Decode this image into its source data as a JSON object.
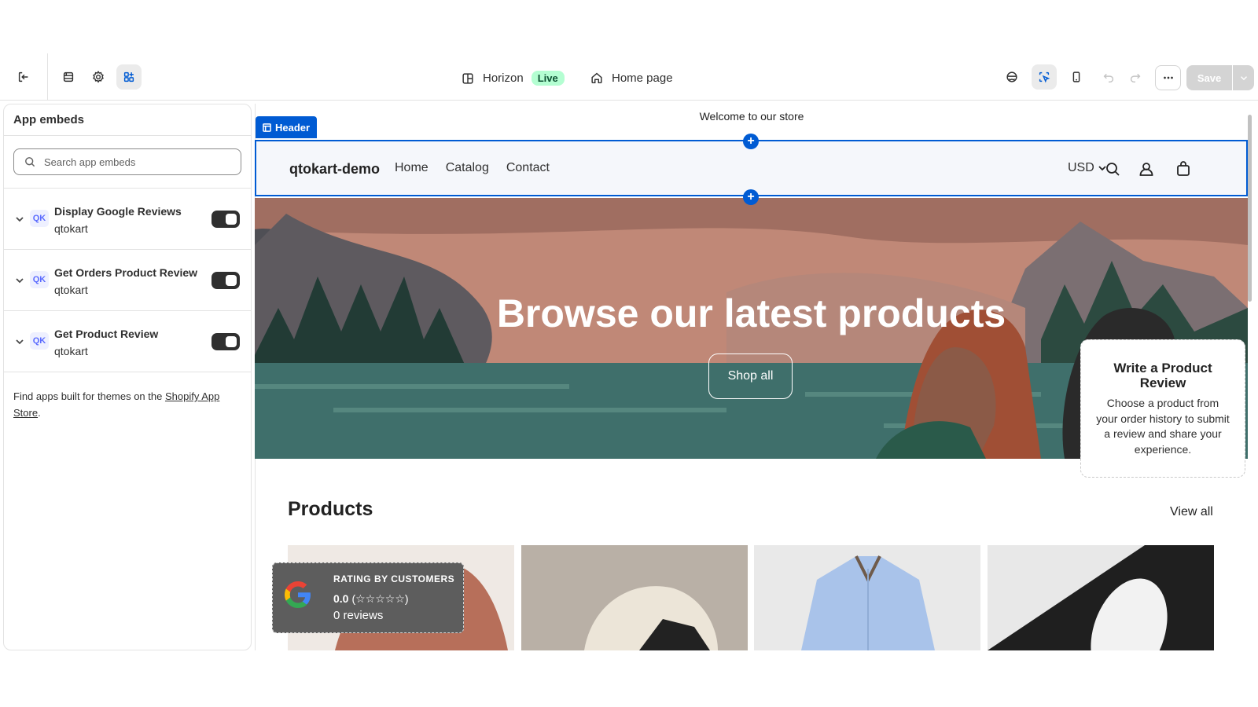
{
  "toolbar": {
    "theme_name": "Horizon",
    "theme_status": "Live",
    "page_selector": "Home page",
    "save_label": "Save"
  },
  "sidebar": {
    "title": "App embeds",
    "search_placeholder": "Search app embeds",
    "embeds": [
      {
        "name": "Display Google Reviews",
        "vendor": "qtokart",
        "enabled": true
      },
      {
        "name": "Get Orders Product Review",
        "vendor": "qtokart",
        "enabled": true
      },
      {
        "name": "Get Product Review",
        "vendor": "qtokart",
        "enabled": true
      }
    ],
    "footer_text": "Find apps built for themes on the",
    "footer_link": "Shopify App Store",
    "footer_end": "."
  },
  "preview": {
    "announcement": "Welcome to our store",
    "section_tag": "Header",
    "brand": "qtokart-demo",
    "nav": [
      "Home",
      "Catalog",
      "Contact"
    ],
    "currency": "USD",
    "hero_title": "Browse our latest products",
    "hero_button": "Shop all",
    "review_card_title": "Write a Product Review",
    "review_card_text": "Choose a product from your order history to submit a review and share your experience.",
    "products_title": "Products",
    "view_all": "View all",
    "rating_badge": {
      "label": "RATING BY CUSTOMERS",
      "score": "0.0",
      "stars": "(☆☆☆☆☆)",
      "count": "0 reviews"
    }
  },
  "colors": {
    "accent_blue": "#005bd3",
    "live_badge": "#b4fed2",
    "toggle_on": "#303030"
  }
}
